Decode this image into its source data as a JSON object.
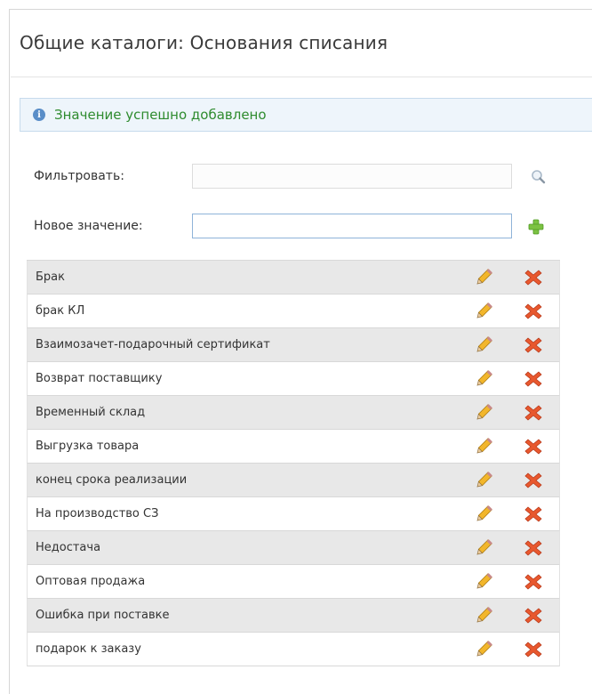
{
  "page": {
    "title": "Общие каталоги: Основания списания"
  },
  "notice": {
    "text": "Значение успешно добавлено",
    "icon": "info-icon",
    "color": "#2e8b2e"
  },
  "filter": {
    "label": "Фильтровать:",
    "value": "",
    "icon": "search-icon"
  },
  "new_value": {
    "label": "Новое значение:",
    "value": "",
    "icon": "add-icon"
  },
  "items": [
    {
      "label": "Брак"
    },
    {
      "label": "брак КЛ"
    },
    {
      "label": "Взаимозачет-подарочный сертификат"
    },
    {
      "label": "Возврат поставщику"
    },
    {
      "label": "Временный склад"
    },
    {
      "label": "Выгрузка товара"
    },
    {
      "label": "конец срока реализации"
    },
    {
      "label": "На производство СЗ"
    },
    {
      "label": "Недостача"
    },
    {
      "label": "Оптовая продажа"
    },
    {
      "label": "Ошибка при поставке"
    },
    {
      "label": "подарок к заказу"
    }
  ],
  "row_icons": {
    "edit": "pencil-icon",
    "delete": "delete-x-icon"
  }
}
